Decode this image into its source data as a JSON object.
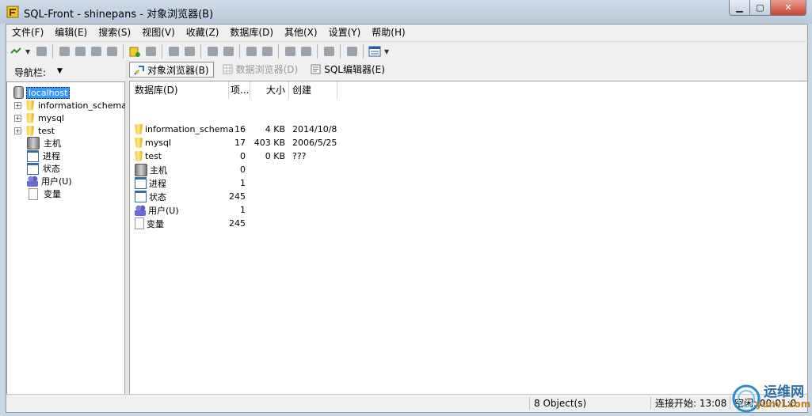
{
  "window": {
    "title": "SQL-Front - shinepans - 对象浏览器(B)"
  },
  "menu": [
    "文件(F)",
    "编辑(E)",
    "搜索(S)",
    "视图(V)",
    "收藏(Z)",
    "数据库(D)",
    "其他(X)",
    "设置(Y)",
    "帮助(H)"
  ],
  "navigation": {
    "label": "导航栏:",
    "tree": [
      {
        "label": "localhost",
        "icon": "server-icon",
        "level": 0,
        "selected": true
      },
      {
        "label": "information_schema",
        "icon": "database-icon",
        "level": 1,
        "expandable": true
      },
      {
        "label": "mysql",
        "icon": "database-icon",
        "level": 1,
        "expandable": true
      },
      {
        "label": "test",
        "icon": "database-icon",
        "level": 1,
        "expandable": true
      },
      {
        "label": "主机",
        "icon": "hosts-icon",
        "level": 1
      },
      {
        "label": "进程",
        "icon": "window-icon",
        "level": 1
      },
      {
        "label": "状态",
        "icon": "window-icon",
        "level": 1
      },
      {
        "label": "用户(U)",
        "icon": "users-icon",
        "level": 1
      },
      {
        "label": "变量",
        "icon": "document-icon",
        "level": 1
      }
    ]
  },
  "view_tabs": [
    {
      "label": "对象浏览器(B)",
      "active": true
    },
    {
      "label": "数据浏览器(D)",
      "disabled": true
    },
    {
      "label": "SQL编辑器(E)"
    }
  ],
  "object_list": {
    "columns": {
      "name": "数据库(D)",
      "objects": "项...",
      "size": "大小",
      "created": "创建"
    },
    "rows": [
      {
        "name": "information_schema",
        "icon": "database-icon",
        "objects": "16",
        "size": "4 KB",
        "created": "2014/10/8"
      },
      {
        "name": "mysql",
        "icon": "database-icon",
        "objects": "17",
        "size": "403 KB",
        "created": "2006/5/25"
      },
      {
        "name": "test",
        "icon": "database-icon",
        "objects": "0",
        "size": "0 KB",
        "created": "???"
      },
      {
        "name": "主机",
        "icon": "hosts-icon",
        "objects": "0",
        "size": "",
        "created": ""
      },
      {
        "name": "进程",
        "icon": "window-icon",
        "objects": "1",
        "size": "",
        "created": ""
      },
      {
        "name": "状态",
        "icon": "window-icon",
        "objects": "245",
        "size": "",
        "created": ""
      },
      {
        "name": "用户(U)",
        "icon": "users-icon",
        "objects": "1",
        "size": "",
        "created": ""
      },
      {
        "name": "变量",
        "icon": "document-icon",
        "objects": "245",
        "size": "",
        "created": ""
      }
    ]
  },
  "status": {
    "objects": "8 Object(s)",
    "connected": "连接开始: 13:08",
    "idle": "空闲: 00:01:0"
  },
  "watermark": {
    "text": "运维网",
    "sub": "yunvi.com"
  }
}
